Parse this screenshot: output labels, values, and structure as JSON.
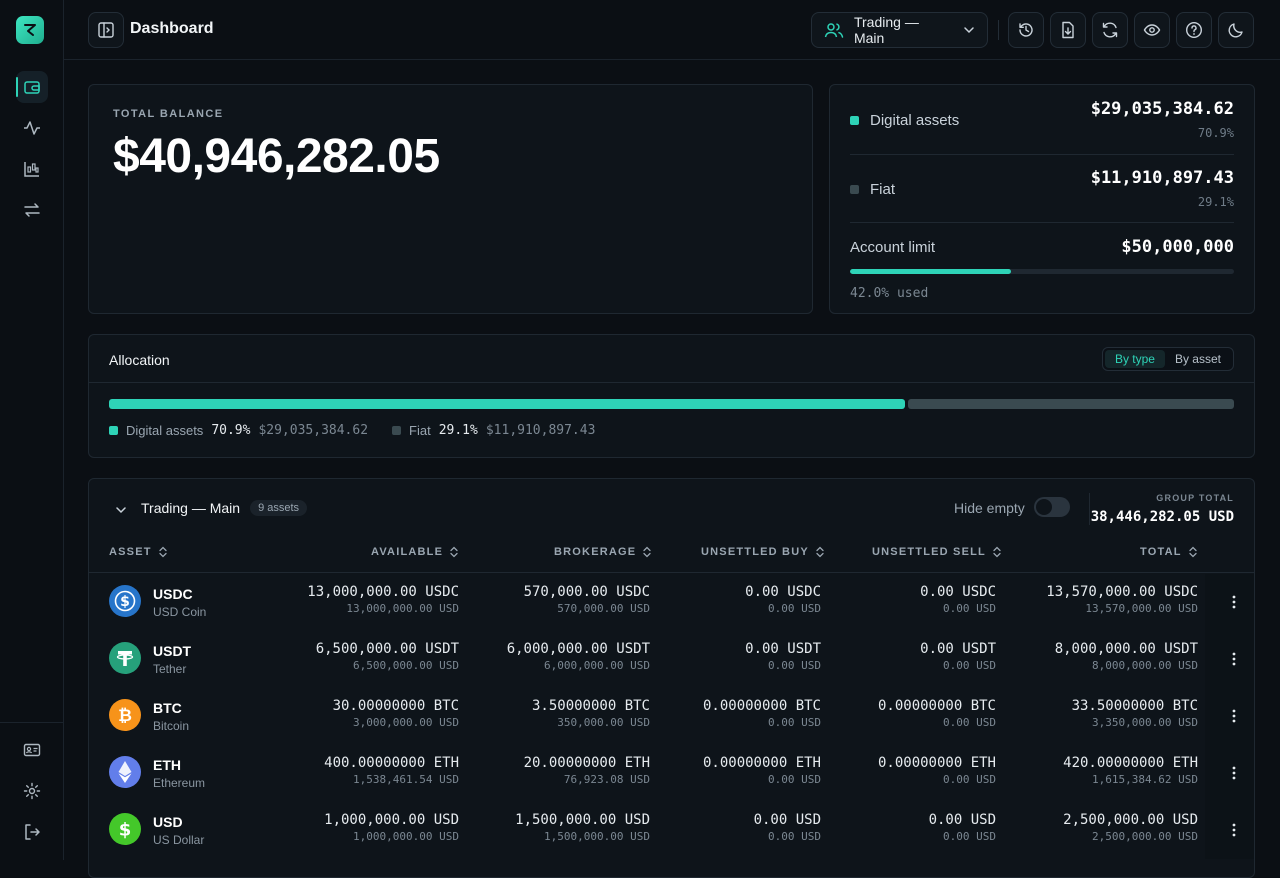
{
  "header": {
    "title": "Dashboard",
    "account": "Trading — Main"
  },
  "balance": {
    "label": "TOTAL BALANCE",
    "value": "$40,946,282.05"
  },
  "summary": {
    "digital_label": "Digital assets",
    "digital_value": "$29,035,384.62",
    "digital_pct": "70.9%",
    "fiat_label": "Fiat",
    "fiat_value": "$11,910,897.43",
    "fiat_pct": "29.1%",
    "limit_label": "Account limit",
    "limit_value": "$50,000,000",
    "limit_used": "42.0% used",
    "limit_fraction": 0.42
  },
  "allocation": {
    "title": "Allocation",
    "toggle_on": "By type",
    "toggle_off": "By asset",
    "digital_fraction": 0.709,
    "legend": [
      {
        "name": "Digital assets",
        "pct": "70.9%",
        "amount": "$29,035,384.62",
        "color": "#2ed3b7"
      },
      {
        "name": "Fiat",
        "pct": "29.1%",
        "amount": "$11,910,897.43",
        "color": "#3a4a50"
      }
    ]
  },
  "group": {
    "title": "Trading — Main",
    "count": "9 assets",
    "hide_empty": "Hide empty",
    "total_label": "GROUP TOTAL",
    "total_value": "38,446,282.05 USD"
  },
  "columns": [
    "ASSET",
    "AVAILABLE",
    "BROKERAGE",
    "UNSETTLED BUY",
    "UNSETTLED SELL",
    "TOTAL"
  ],
  "rows": [
    {
      "sym": "USDC",
      "name": "USD Coin",
      "icon": "usdc-icon",
      "color": "#2775ca",
      "available": [
        "13,000,000.00 USDC",
        "13,000,000.00 USD"
      ],
      "brokerage": [
        "570,000.00 USDC",
        "570,000.00 USD"
      ],
      "ubuy": [
        "0.00 USDC",
        "0.00 USD"
      ],
      "usell": [
        "0.00 USDC",
        "0.00 USD"
      ],
      "total": [
        "13,570,000.00 USDC",
        "13,570,000.00 USD"
      ]
    },
    {
      "sym": "USDT",
      "name": "Tether",
      "icon": "tether-icon",
      "color": "#26a17b",
      "available": [
        "6,500,000.00 USDT",
        "6,500,000.00 USD"
      ],
      "brokerage": [
        "6,000,000.00 USDT",
        "6,000,000.00 USD"
      ],
      "ubuy": [
        "0.00 USDT",
        "0.00 USD"
      ],
      "usell": [
        "0.00 USDT",
        "0.00 USD"
      ],
      "total": [
        "8,000,000.00 USDT",
        "8,000,000.00 USD"
      ]
    },
    {
      "sym": "BTC",
      "name": "Bitcoin",
      "icon": "bitcoin-icon",
      "color": "#f7931a",
      "available": [
        "30.00000000 BTC",
        "3,000,000.00 USD"
      ],
      "brokerage": [
        "3.50000000 BTC",
        "350,000.00 USD"
      ],
      "ubuy": [
        "0.00000000 BTC",
        "0.00 USD"
      ],
      "usell": [
        "0.00000000 BTC",
        "0.00 USD"
      ],
      "total": [
        "33.50000000 BTC",
        "3,350,000.00 USD"
      ]
    },
    {
      "sym": "ETH",
      "name": "Ethereum",
      "icon": "ethereum-icon",
      "color": "#627eea",
      "available": [
        "400.00000000 ETH",
        "1,538,461.54 USD"
      ],
      "brokerage": [
        "20.00000000 ETH",
        "76,923.08 USD"
      ],
      "ubuy": [
        "0.00000000 ETH",
        "0.00 USD"
      ],
      "usell": [
        "0.00000000 ETH",
        "0.00 USD"
      ],
      "total": [
        "420.00000000 ETH",
        "1,615,384.62 USD"
      ]
    },
    {
      "sym": "USD",
      "name": "US Dollar",
      "icon": "dollar-icon",
      "color": "#44c82a",
      "available": [
        "1,000,000.00 USD",
        "1,000,000.00 USD"
      ],
      "brokerage": [
        "1,500,000.00 USD",
        "1,500,000.00 USD"
      ],
      "ubuy": [
        "0.00 USD",
        "0.00 USD"
      ],
      "usell": [
        "0.00 USD",
        "0.00 USD"
      ],
      "total": [
        "2,500,000.00 USD",
        "2,500,000.00 USD"
      ]
    }
  ]
}
